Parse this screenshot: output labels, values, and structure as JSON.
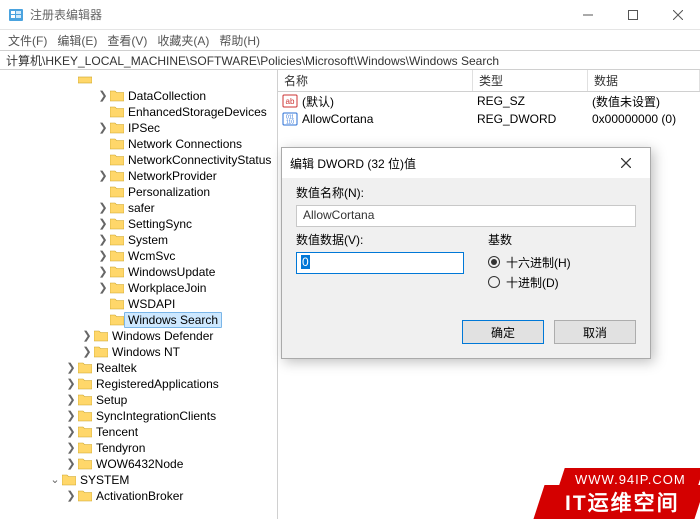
{
  "window": {
    "title": "注册表编辑器"
  },
  "menu": {
    "file": "文件(F)",
    "edit": "编辑(E)",
    "view": "查看(V)",
    "fav": "收藏夹(A)",
    "help": "帮助(H)"
  },
  "address": "计算机\\HKEY_LOCAL_MACHINE\\SOFTWARE\\Policies\\Microsoft\\Windows\\Windows Search",
  "columns": {
    "name": "名称",
    "type": "类型",
    "data": "数据"
  },
  "values": [
    {
      "icon": "string",
      "name": "(默认)",
      "type": "REG_SZ",
      "data": "(数值未设置)"
    },
    {
      "icon": "dword",
      "name": "AllowCortana",
      "type": "REG_DWORD",
      "data": "0x00000000 (0)"
    }
  ],
  "tree_level1": [
    {
      "t": ">",
      "l": "DataCollection"
    },
    {
      "t": "",
      "l": "EnhancedStorageDevices"
    },
    {
      "t": ">",
      "l": "IPSec"
    },
    {
      "t": "",
      "l": "Network Connections"
    },
    {
      "t": "",
      "l": "NetworkConnectivityStatus"
    },
    {
      "t": ">",
      "l": "NetworkProvider"
    },
    {
      "t": "",
      "l": "Personalization"
    },
    {
      "t": ">",
      "l": "safer"
    },
    {
      "t": ">",
      "l": "SettingSync"
    },
    {
      "t": ">",
      "l": "System"
    },
    {
      "t": ">",
      "l": "WcmSvc"
    },
    {
      "t": ">",
      "l": "WindowsUpdate"
    },
    {
      "t": ">",
      "l": "WorkplaceJoin"
    },
    {
      "t": "",
      "l": "WSDAPI"
    },
    {
      "t": "",
      "l": "Windows Search",
      "sel": true
    }
  ],
  "tree_level2": [
    {
      "t": ">",
      "l": "Windows Defender"
    },
    {
      "t": ">",
      "l": "Windows NT"
    }
  ],
  "tree_level3": [
    {
      "t": ">",
      "l": "Realtek"
    },
    {
      "t": ">",
      "l": "RegisteredApplications"
    },
    {
      "t": ">",
      "l": "Setup"
    },
    {
      "t": ">",
      "l": "SyncIntegrationClients"
    },
    {
      "t": ">",
      "l": "Tencent"
    },
    {
      "t": ">",
      "l": "Tendyron"
    },
    {
      "t": ">",
      "l": "WOW6432Node"
    }
  ],
  "tree_system": {
    "t": "v",
    "l": "SYSTEM"
  },
  "tree_system_children": [
    {
      "t": ">",
      "l": "ActivationBroker"
    }
  ],
  "dialog": {
    "title": "编辑 DWORD (32 位)值",
    "name_label": "数值名称(N):",
    "name_value": "AllowCortana",
    "data_label": "数值数据(V):",
    "data_value": "0",
    "base_label": "基数",
    "hex": "十六进制(H)",
    "dec": "十进制(D)",
    "ok": "确定",
    "cancel": "取消"
  },
  "watermark": {
    "url": "WWW.94IP.COM",
    "brand": "IT运维空间"
  }
}
